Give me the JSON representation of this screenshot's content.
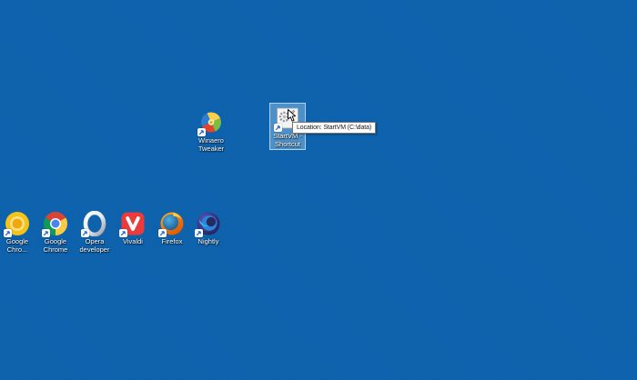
{
  "desktop": {
    "background_color": "#0e63ae"
  },
  "icons": [
    {
      "id": "winaero-tweaker",
      "label_line1": "Winaero",
      "label_line2": "Tweaker",
      "selected": false
    },
    {
      "id": "startvm-shortcut",
      "label_line1": "StartVM -",
      "label_line2": "Shortcut",
      "selected": true
    },
    {
      "id": "google-chrome-canary",
      "label_line1": "Google",
      "label_line2": "Chro...",
      "selected": false
    },
    {
      "id": "google-chrome",
      "label_line1": "Google",
      "label_line2": "Chrome",
      "selected": false
    },
    {
      "id": "opera-developer",
      "label_line1": "Opera",
      "label_line2": "developer",
      "selected": false
    },
    {
      "id": "vivaldi",
      "label_line1": "Vivaldi",
      "label_line2": "",
      "selected": false
    },
    {
      "id": "firefox",
      "label_line1": "Firefox",
      "label_line2": "",
      "selected": false
    },
    {
      "id": "nightly",
      "label_line1": "Nightly",
      "label_line2": "",
      "selected": false
    }
  ],
  "tooltip": {
    "text": "Location: StartVM (C:\\data)"
  },
  "colors": {
    "selection_fill": "#8cbfe8",
    "tooltip_background": "#ffffff",
    "tooltip_border": "#767676",
    "label_text": "#ffffff",
    "shortcut_arrow": "#1d62d1"
  }
}
